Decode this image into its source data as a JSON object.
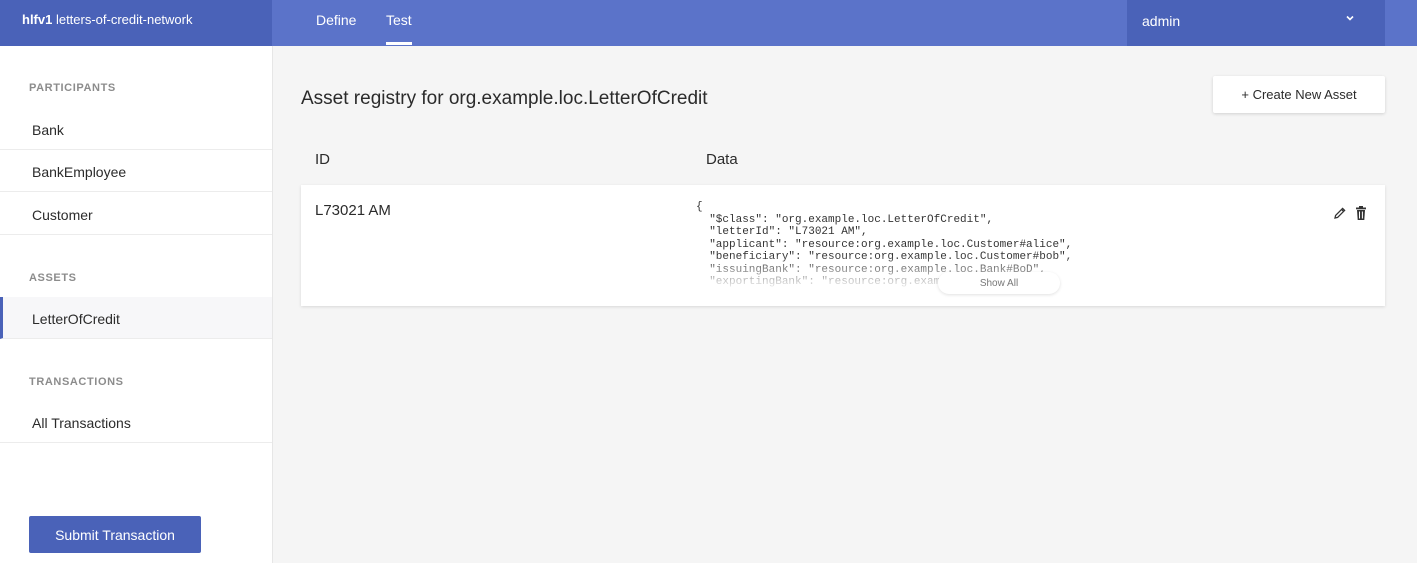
{
  "header": {
    "brand_bold": "hlfv1",
    "brand_name": " letters-of-credit-network",
    "tabs": [
      {
        "label": "Define"
      },
      {
        "label": "Test"
      }
    ],
    "user": "admin"
  },
  "sidebar": {
    "participants_label": "PARTICIPANTS",
    "participants": [
      {
        "label": "Bank"
      },
      {
        "label": "BankEmployee"
      },
      {
        "label": "Customer"
      }
    ],
    "assets_label": "ASSETS",
    "assets": [
      {
        "label": "LetterOfCredit"
      }
    ],
    "transactions_label": "TRANSACTIONS",
    "transactions": [
      {
        "label": "All Transactions"
      }
    ],
    "submit_label": "Submit Transaction"
  },
  "main": {
    "title": "Asset registry for org.example.loc.LetterOfCredit",
    "create_label": "+ Create New Asset",
    "columns": {
      "id": "ID",
      "data": "Data"
    },
    "rows": [
      {
        "id": "L73021 AM",
        "data": "{\n  \"$class\": \"org.example.loc.LetterOfCredit\",\n  \"letterId\": \"L73021 AM\",\n  \"applicant\": \"resource:org.example.loc.Customer#alice\",\n  \"beneficiary\": \"resource:org.example.loc.Customer#bob\",\n  \"issuingBank\": \"resource:org.example.loc.Bank#BoD\",\n  \"exportingBank\": \"resource:org.example.loc.Bank#EB\",",
        "show_all_label": "Show All"
      }
    ]
  },
  "colors": {
    "header": "#5b73c9",
    "header_dark": "#4a62b8",
    "accent": "#4a62b8"
  }
}
